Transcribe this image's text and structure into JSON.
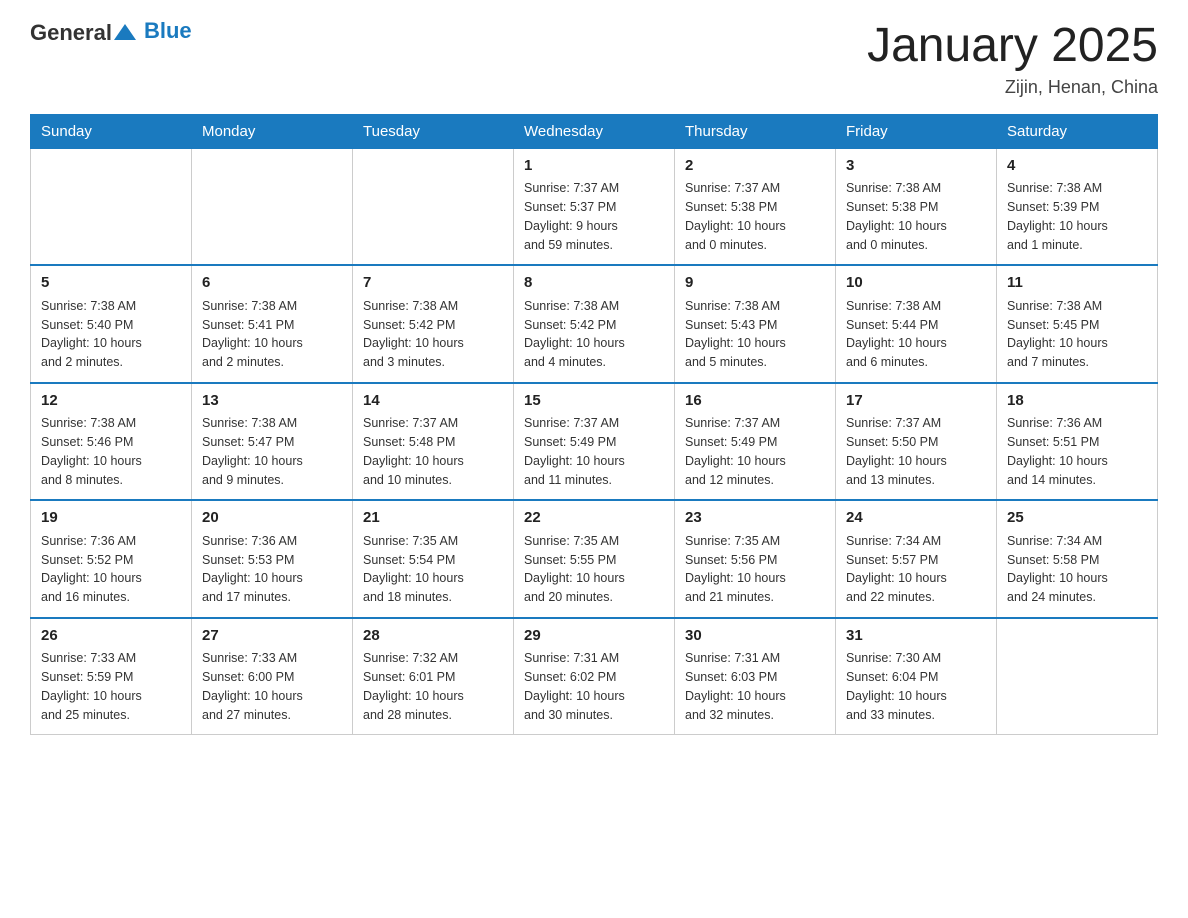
{
  "header": {
    "logo_general": "General",
    "logo_blue": "Blue",
    "title": "January 2025",
    "location": "Zijin, Henan, China"
  },
  "weekdays": [
    "Sunday",
    "Monday",
    "Tuesday",
    "Wednesday",
    "Thursday",
    "Friday",
    "Saturday"
  ],
  "weeks": [
    [
      {
        "day": "",
        "info": ""
      },
      {
        "day": "",
        "info": ""
      },
      {
        "day": "",
        "info": ""
      },
      {
        "day": "1",
        "info": "Sunrise: 7:37 AM\nSunset: 5:37 PM\nDaylight: 9 hours\nand 59 minutes."
      },
      {
        "day": "2",
        "info": "Sunrise: 7:37 AM\nSunset: 5:38 PM\nDaylight: 10 hours\nand 0 minutes."
      },
      {
        "day": "3",
        "info": "Sunrise: 7:38 AM\nSunset: 5:38 PM\nDaylight: 10 hours\nand 0 minutes."
      },
      {
        "day": "4",
        "info": "Sunrise: 7:38 AM\nSunset: 5:39 PM\nDaylight: 10 hours\nand 1 minute."
      }
    ],
    [
      {
        "day": "5",
        "info": "Sunrise: 7:38 AM\nSunset: 5:40 PM\nDaylight: 10 hours\nand 2 minutes."
      },
      {
        "day": "6",
        "info": "Sunrise: 7:38 AM\nSunset: 5:41 PM\nDaylight: 10 hours\nand 2 minutes."
      },
      {
        "day": "7",
        "info": "Sunrise: 7:38 AM\nSunset: 5:42 PM\nDaylight: 10 hours\nand 3 minutes."
      },
      {
        "day": "8",
        "info": "Sunrise: 7:38 AM\nSunset: 5:42 PM\nDaylight: 10 hours\nand 4 minutes."
      },
      {
        "day": "9",
        "info": "Sunrise: 7:38 AM\nSunset: 5:43 PM\nDaylight: 10 hours\nand 5 minutes."
      },
      {
        "day": "10",
        "info": "Sunrise: 7:38 AM\nSunset: 5:44 PM\nDaylight: 10 hours\nand 6 minutes."
      },
      {
        "day": "11",
        "info": "Sunrise: 7:38 AM\nSunset: 5:45 PM\nDaylight: 10 hours\nand 7 minutes."
      }
    ],
    [
      {
        "day": "12",
        "info": "Sunrise: 7:38 AM\nSunset: 5:46 PM\nDaylight: 10 hours\nand 8 minutes."
      },
      {
        "day": "13",
        "info": "Sunrise: 7:38 AM\nSunset: 5:47 PM\nDaylight: 10 hours\nand 9 minutes."
      },
      {
        "day": "14",
        "info": "Sunrise: 7:37 AM\nSunset: 5:48 PM\nDaylight: 10 hours\nand 10 minutes."
      },
      {
        "day": "15",
        "info": "Sunrise: 7:37 AM\nSunset: 5:49 PM\nDaylight: 10 hours\nand 11 minutes."
      },
      {
        "day": "16",
        "info": "Sunrise: 7:37 AM\nSunset: 5:49 PM\nDaylight: 10 hours\nand 12 minutes."
      },
      {
        "day": "17",
        "info": "Sunrise: 7:37 AM\nSunset: 5:50 PM\nDaylight: 10 hours\nand 13 minutes."
      },
      {
        "day": "18",
        "info": "Sunrise: 7:36 AM\nSunset: 5:51 PM\nDaylight: 10 hours\nand 14 minutes."
      }
    ],
    [
      {
        "day": "19",
        "info": "Sunrise: 7:36 AM\nSunset: 5:52 PM\nDaylight: 10 hours\nand 16 minutes."
      },
      {
        "day": "20",
        "info": "Sunrise: 7:36 AM\nSunset: 5:53 PM\nDaylight: 10 hours\nand 17 minutes."
      },
      {
        "day": "21",
        "info": "Sunrise: 7:35 AM\nSunset: 5:54 PM\nDaylight: 10 hours\nand 18 minutes."
      },
      {
        "day": "22",
        "info": "Sunrise: 7:35 AM\nSunset: 5:55 PM\nDaylight: 10 hours\nand 20 minutes."
      },
      {
        "day": "23",
        "info": "Sunrise: 7:35 AM\nSunset: 5:56 PM\nDaylight: 10 hours\nand 21 minutes."
      },
      {
        "day": "24",
        "info": "Sunrise: 7:34 AM\nSunset: 5:57 PM\nDaylight: 10 hours\nand 22 minutes."
      },
      {
        "day": "25",
        "info": "Sunrise: 7:34 AM\nSunset: 5:58 PM\nDaylight: 10 hours\nand 24 minutes."
      }
    ],
    [
      {
        "day": "26",
        "info": "Sunrise: 7:33 AM\nSunset: 5:59 PM\nDaylight: 10 hours\nand 25 minutes."
      },
      {
        "day": "27",
        "info": "Sunrise: 7:33 AM\nSunset: 6:00 PM\nDaylight: 10 hours\nand 27 minutes."
      },
      {
        "day": "28",
        "info": "Sunrise: 7:32 AM\nSunset: 6:01 PM\nDaylight: 10 hours\nand 28 minutes."
      },
      {
        "day": "29",
        "info": "Sunrise: 7:31 AM\nSunset: 6:02 PM\nDaylight: 10 hours\nand 30 minutes."
      },
      {
        "day": "30",
        "info": "Sunrise: 7:31 AM\nSunset: 6:03 PM\nDaylight: 10 hours\nand 32 minutes."
      },
      {
        "day": "31",
        "info": "Sunrise: 7:30 AM\nSunset: 6:04 PM\nDaylight: 10 hours\nand 33 minutes."
      },
      {
        "day": "",
        "info": ""
      }
    ]
  ]
}
